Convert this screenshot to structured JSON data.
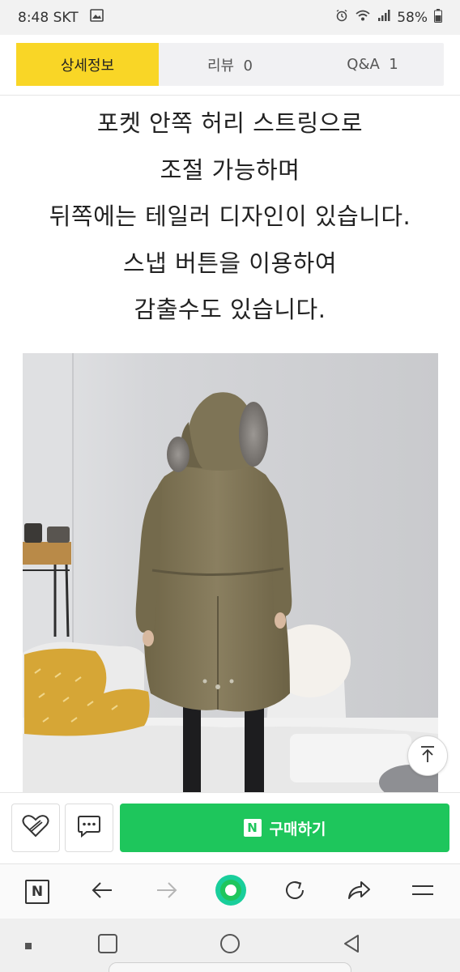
{
  "status_bar": {
    "time": "8:48",
    "carrier": "SKT",
    "battery": "58%",
    "icons": [
      "gallery-icon",
      "alarm-icon",
      "wifi-icon",
      "signal-icon",
      "battery-icon"
    ]
  },
  "tabs": [
    {
      "label": "상세정보",
      "active": true
    },
    {
      "label": "리뷰  0",
      "active": false
    },
    {
      "label": "Q&A  1",
      "active": false
    }
  ],
  "description": [
    "포켓 안쪽 허리 스트링으로",
    "조절 가능하며",
    "뒤쪽에는 테일러 디자인이 있습니다.",
    "스냅 버튼을 이용하여",
    "감출수도 있습니다."
  ],
  "actions": {
    "like_icon": "heart-icon",
    "talk_icon": "chat-icon",
    "buy_badge": "N",
    "buy_label": "구매하기"
  },
  "browser_bar": {
    "home_badge": "N",
    "icons": [
      "naver-home-icon",
      "back-arrow-icon",
      "forward-arrow-icon",
      "green-dot-icon",
      "refresh-icon",
      "share-icon",
      "menu-icon"
    ]
  },
  "system_nav": {
    "icons": [
      "recent-apps-icon",
      "home-icon",
      "back-icon"
    ]
  },
  "colors": {
    "tab_active": "#f9d626",
    "buy_button": "#1ec65c",
    "coat": "#857a5c"
  }
}
